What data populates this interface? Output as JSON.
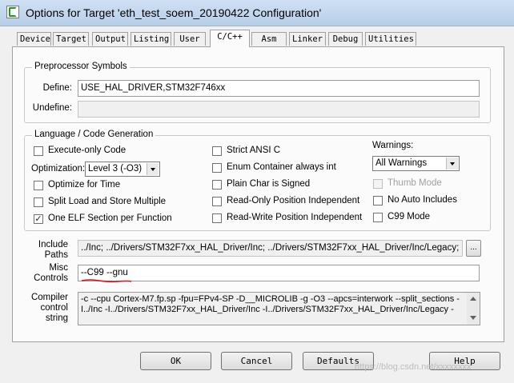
{
  "window": {
    "title": "Options for Target 'eth_test_soem_20190422 Configuration'"
  },
  "tabs": [
    {
      "label": "Device"
    },
    {
      "label": "Target"
    },
    {
      "label": "Output"
    },
    {
      "label": "Listing"
    },
    {
      "label": "User"
    },
    {
      "label": "C/C++",
      "active": true
    },
    {
      "label": "Asm"
    },
    {
      "label": "Linker"
    },
    {
      "label": "Debug"
    },
    {
      "label": "Utilities"
    }
  ],
  "preprocessor": {
    "legend": "Preprocessor Symbols",
    "define_label": "Define:",
    "define_value": "USE_HAL_DRIVER,STM32F746xx",
    "undefine_label": "Undefine:",
    "undefine_value": ""
  },
  "language": {
    "legend": "Language / Code Generation",
    "execute_only": {
      "label": "Execute-only Code",
      "checked": false
    },
    "optimization_label": "Optimization:",
    "optimization_value": "Level 3 (-O3)",
    "optimize_time": {
      "label": "Optimize for Time",
      "checked": false
    },
    "split_load": {
      "label": "Split Load and Store Multiple",
      "checked": false
    },
    "one_elf": {
      "label": "One ELF Section per Function",
      "checked": true
    },
    "strict_ansi": {
      "label": "Strict ANSI C",
      "checked": false
    },
    "enum_container": {
      "label": "Enum Container always int",
      "checked": false
    },
    "plain_char": {
      "label": "Plain Char is Signed",
      "checked": false
    },
    "ro_pos": {
      "label": "Read-Only Position Independent",
      "checked": false
    },
    "rw_pos": {
      "label": "Read-Write Position Independent",
      "checked": false
    },
    "warnings_label": "Warnings:",
    "warnings_value": "All Warnings",
    "thumb_mode": {
      "label": "Thumb Mode",
      "checked": false,
      "disabled": true
    },
    "no_auto_includes": {
      "label": "No Auto Includes",
      "checked": false
    },
    "c99_mode": {
      "label": "C99 Mode",
      "checked": false
    }
  },
  "include_paths": {
    "label_line1": "Include",
    "label_line2": "Paths",
    "value": "../Inc; ../Drivers/STM32F7xx_HAL_Driver/Inc; ../Drivers/STM32F7xx_HAL_Driver/Inc/Legacy; ../D",
    "browse_label": "..."
  },
  "misc_controls": {
    "label_line1": "Misc",
    "label_line2": "Controls",
    "value": "--C99 --gnu",
    "annotation_color": "#e01010"
  },
  "compiler_control": {
    "label_line1": "Compiler",
    "label_line2": "control",
    "label_line3": "string",
    "line1": "-c --cpu Cortex-M7.fp.sp -fpu=FPv4-SP -D__MICROLIB -g -O3 --apcs=interwork --split_sections -",
    "line2": "I../Inc -I../Drivers/STM32F7xx_HAL_Driver/Inc -I../Drivers/STM32F7xx_HAL_Driver/Inc/Legacy -"
  },
  "buttons": {
    "ok": "OK",
    "cancel": "Cancel",
    "defaults": "Defaults",
    "help": "Help"
  },
  "watermark": "https://blog.csdn.net/xxxxxxxx"
}
